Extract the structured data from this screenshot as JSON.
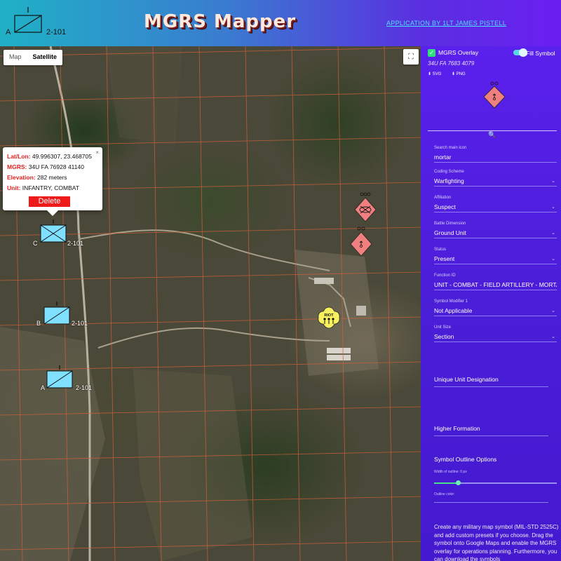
{
  "header": {
    "title": "MGRS Mapper",
    "credit": "APPLICATION BY 1LT JAMES PISTELL",
    "logo": {
      "designator_left": "A",
      "designator_right": "2-101",
      "echelon": "I"
    }
  },
  "map": {
    "type_controls": [
      "Map",
      "Satellite"
    ],
    "active_type": "Satellite",
    "fullscreen_icon": "fullscreen-icon",
    "popup": {
      "latlon_label": "Lat/Lon:",
      "latlon_value": "49.996307, 23.468705",
      "mgrs_label": "MGRS:",
      "mgrs_value": "34U FA 76928 41140",
      "elevation_label": "Elevation:",
      "elevation_value": "282 meters",
      "unit_label": "Unit:",
      "unit_value": "INFANTRY, COMBAT",
      "delete_label": "Delete",
      "close_label": "×"
    },
    "units": [
      {
        "letter": "C",
        "number": "2-101"
      },
      {
        "letter": "B",
        "number": "2-101"
      },
      {
        "letter": "A",
        "number": "2-101"
      }
    ],
    "riot_label": "RIOT",
    "colors": {
      "grid": "#d2603a",
      "friendly": "#80e0ff",
      "suspect": "#f08080",
      "neutral": "#f7f060"
    }
  },
  "sidebar": {
    "overlay_label": "MGRS Overlay",
    "fill_label": "Fill Symbol",
    "mgrs_value": "34U FA 7683 4079",
    "download_svg": "SVG",
    "download_png": "PNG",
    "fields": [
      {
        "label": "Search main icon",
        "value": "mortar"
      },
      {
        "label": "Coding Scheme",
        "value": "Warfighting"
      },
      {
        "label": "Affiliation",
        "value": "Suspect"
      },
      {
        "label": "Battle Dimension",
        "value": "Ground Unit"
      },
      {
        "label": "Status",
        "value": "Present"
      },
      {
        "label": "Function ID",
        "value": "UNIT - COMBAT - FIELD ARTILLERY - MORTA"
      },
      {
        "label": "Symbol Modifier 1",
        "value": "Not Applicable"
      },
      {
        "label": "Unit Size",
        "value": "Section"
      }
    ],
    "unique_designation": "Unique Unit Designation",
    "higher_formation": "Higher Formation",
    "outline_options": "Symbol Outline Options",
    "outline_width": "Width of outline: 0 px",
    "outline_color": "Outline color:",
    "outline_fraction": 0.19,
    "description": "Create any military map symbol (MIL-STD 2525C) and add custom presets if you choose. Drag the symbol onto Google Maps and enable the MGRS overlay for operations planning. Furthermore, you can download the symbols"
  }
}
